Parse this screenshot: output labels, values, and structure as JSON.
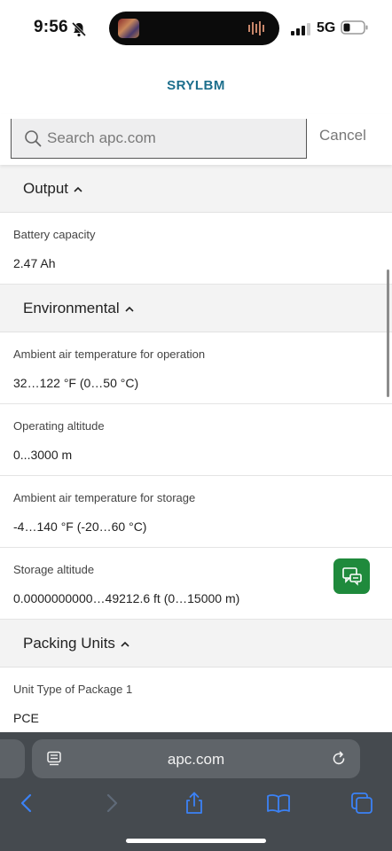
{
  "status": {
    "time": "9:56",
    "network": "5G"
  },
  "header": {
    "title": "SRYLBM"
  },
  "search": {
    "placeholder": "Search apc.com",
    "value": "",
    "cancel_label": "Cancel"
  },
  "sections": [
    {
      "title": "Output",
      "rows": [
        {
          "label": "Battery capacity",
          "value": "2.47 Ah"
        }
      ]
    },
    {
      "title": "Environmental",
      "rows": [
        {
          "label": "Ambient air temperature for operation",
          "value": "32…122 °F (0…50 °C)"
        },
        {
          "label": "Operating altitude",
          "value": "0...3000 m"
        },
        {
          "label": "Ambient air temperature for storage",
          "value": "-4…140 °F (-20…60 °C)"
        },
        {
          "label": "Storage altitude",
          "value": "0.0000000000…49212.6 ft (0…15000 m)"
        }
      ]
    },
    {
      "title": "Packing Units",
      "rows": [
        {
          "label": "Unit Type of Package 1",
          "value": "PCE"
        }
      ]
    }
  ],
  "browser": {
    "url": "apc.com"
  },
  "colors": {
    "brand": "#1c6e8c",
    "chat_button": "#1f8a3c",
    "toolbar_icon": "#3b82f6",
    "browser_bar": "#454a4f"
  },
  "icons": {
    "status": [
      "bell-slash-icon",
      "signal-icon",
      "battery-icon"
    ],
    "search": "search-icon",
    "chat": "chat-support-icon",
    "browser": [
      "reader-mode-icon",
      "reload-icon",
      "back-icon",
      "forward-icon",
      "share-icon",
      "bookmarks-icon",
      "tabs-icon"
    ]
  }
}
